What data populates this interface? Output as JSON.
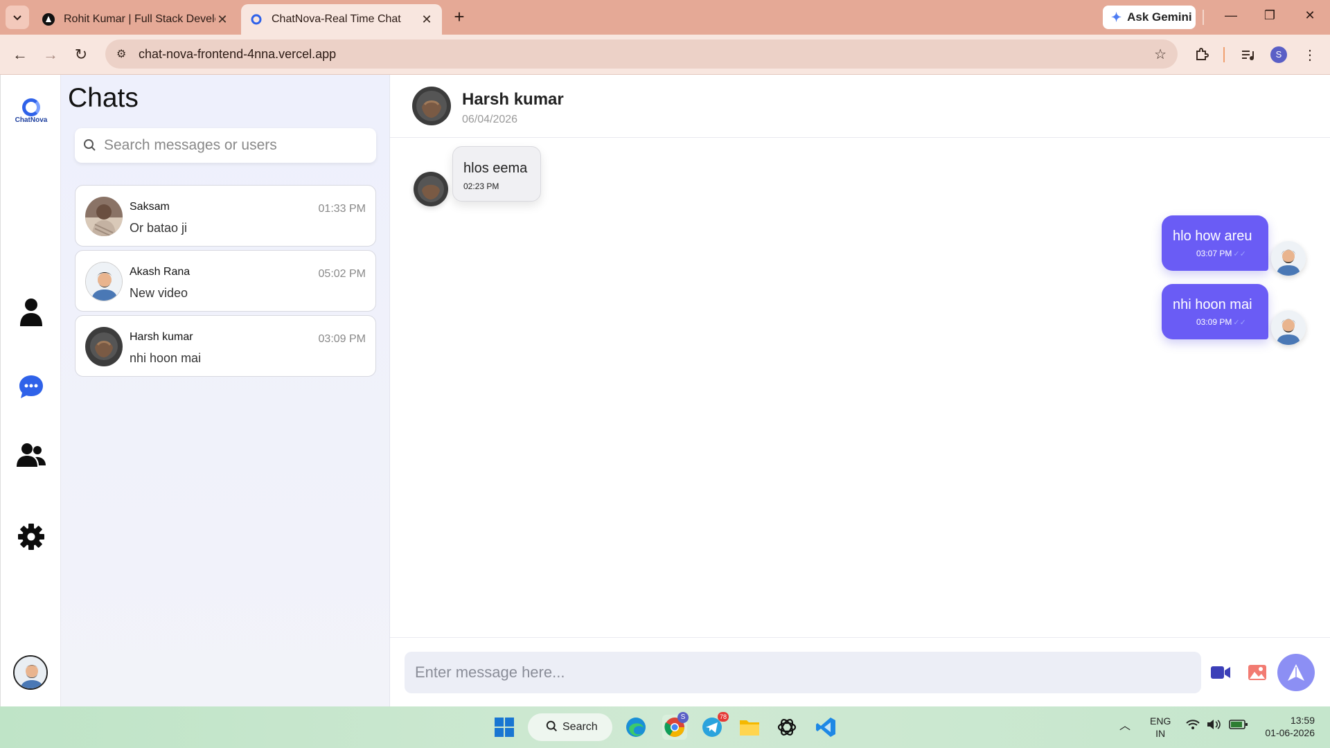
{
  "browser": {
    "tabs": [
      {
        "title": "Rohit Kumar | Full Stack Develo",
        "active": false
      },
      {
        "title": "ChatNova-Real Time Chat",
        "active": true
      }
    ],
    "ask_gemini": "Ask Gemini",
    "url": "chat-nova-frontend-4nna.vercel.app",
    "profile_initial": "S"
  },
  "app": {
    "logo_text": "ChatNova",
    "chats_title": "Chats",
    "search_placeholder": "Search messages or users",
    "chats": [
      {
        "name": "Saksam",
        "preview": "Or batao ji",
        "time": "01:33 PM"
      },
      {
        "name": "Akash Rana",
        "preview": "New video",
        "time": "05:02 PM"
      },
      {
        "name": "Harsh kumar",
        "preview": "nhi hoon mai",
        "time": "03:09 PM"
      }
    ],
    "conversation": {
      "name": "Harsh kumar",
      "date": "06/04/2026",
      "messages": [
        {
          "direction": "in",
          "text": "hlos eema",
          "time": "02:23 PM"
        },
        {
          "direction": "out",
          "text": "hlo how areu",
          "time": "03:07 PM"
        },
        {
          "direction": "out",
          "text": "nhi hoon mai",
          "time": "03:09 PM"
        }
      ],
      "composer_placeholder": "Enter message here..."
    },
    "accent_color": "#6a5cf5",
    "nav_active_color": "#2f62e9"
  },
  "taskbar": {
    "search_label": "Search",
    "telegram_badge": "78",
    "chrome_badge": "S",
    "lang_line1": "ENG",
    "lang_line2": "IN",
    "time": "13:59",
    "date": "01-06-2026"
  }
}
